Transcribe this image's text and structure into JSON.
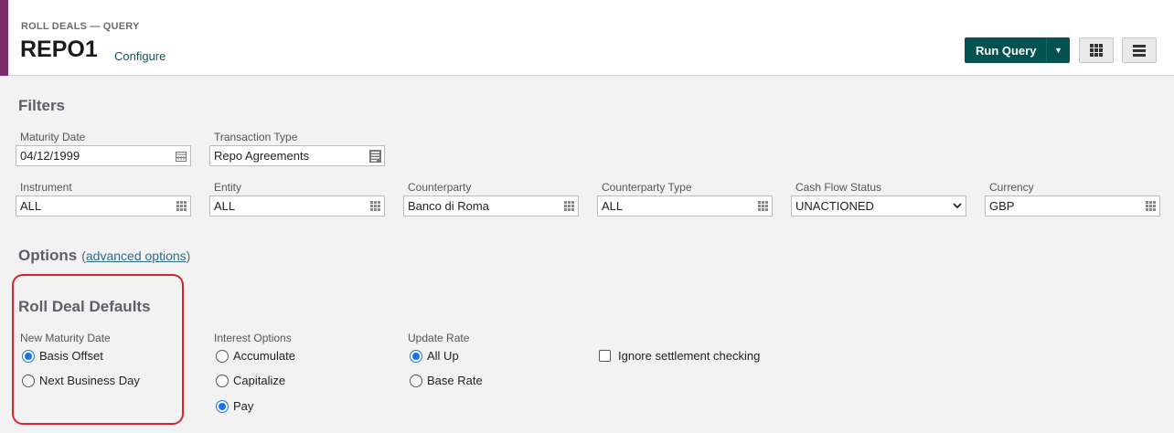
{
  "header": {
    "breadcrumb": "ROLL DEALS — QUERY",
    "title": "REPO1",
    "configure_label": "Configure",
    "run_query_label": "Run Query"
  },
  "filters": {
    "title": "Filters",
    "maturity_date": {
      "label": "Maturity Date",
      "value": "04/12/1999"
    },
    "transaction_type": {
      "label": "Transaction Type",
      "value": "Repo Agreements"
    },
    "instrument": {
      "label": "Instrument",
      "value": "ALL"
    },
    "entity": {
      "label": "Entity",
      "value": "ALL"
    },
    "counterparty": {
      "label": "Counterparty",
      "value": "Banco di Roma"
    },
    "counterparty_type": {
      "label": "Counterparty Type",
      "value": "ALL"
    },
    "cash_flow_status": {
      "label": "Cash Flow Status",
      "value": "UNACTIONED"
    },
    "currency": {
      "label": "Currency",
      "value": "GBP"
    }
  },
  "options": {
    "title": "Options",
    "paren_open": "(",
    "advanced_label": "advanced options",
    "paren_close": ")"
  },
  "roll_defaults": {
    "title": "Roll Deal Defaults",
    "new_maturity": {
      "label": "New Maturity Date",
      "opt1": "Basis Offset",
      "opt2": "Next Business Day",
      "selected": "Basis Offset"
    },
    "interest": {
      "label": "Interest Options",
      "opt1": "Accumulate",
      "opt2": "Capitalize",
      "opt3": "Pay",
      "selected": "Pay"
    },
    "update_rate": {
      "label": "Update Rate",
      "opt1": "All Up",
      "opt2": "Base Rate",
      "selected": "All Up"
    },
    "ignore_settlement": {
      "label": "Ignore settlement checking",
      "checked": false
    }
  },
  "colors": {
    "accent": "#7b2d6b",
    "primary_button": "#03524f",
    "radio_selected": "#1a73e8",
    "highlight": "#d9232d"
  },
  "icons": {
    "date": "calendar-icon",
    "lookup": "grid-icon",
    "menu": "hamburger-icon"
  }
}
